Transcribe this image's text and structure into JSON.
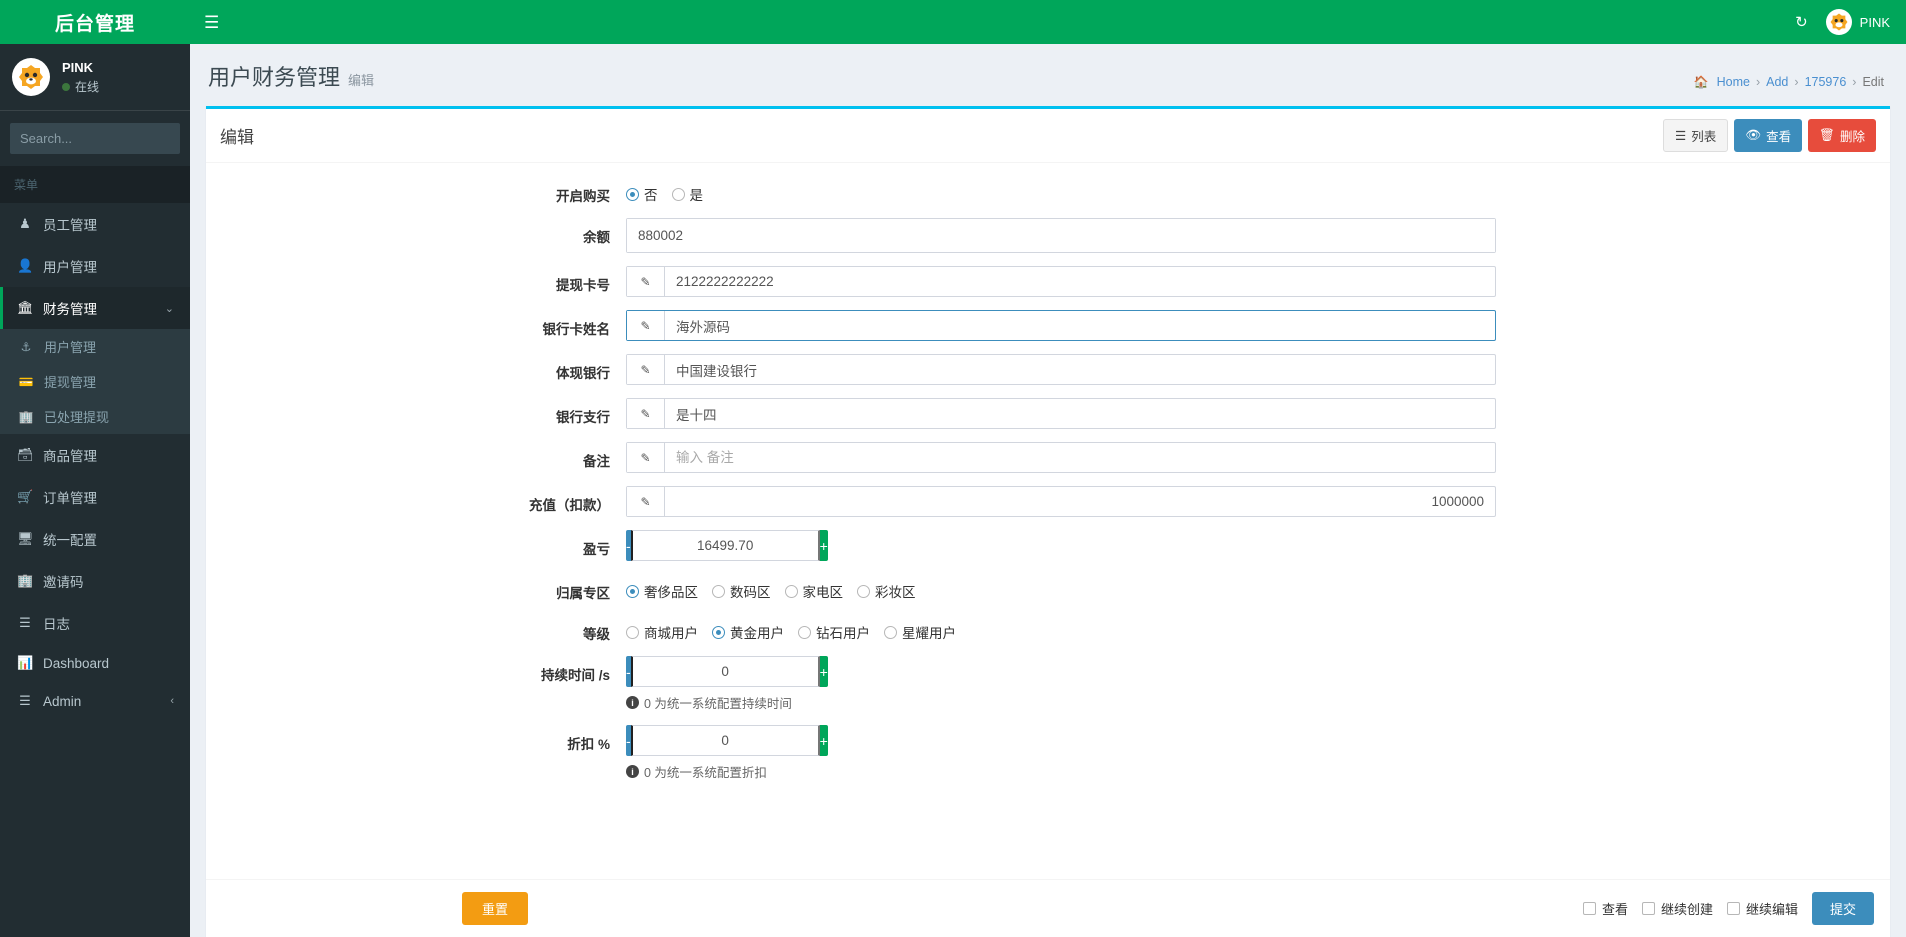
{
  "sidebar": {
    "logo": "后台管理",
    "user": {
      "name": "PINK",
      "status": "在线"
    },
    "search_placeholder": "Search...",
    "menu_header": "菜单",
    "items": [
      {
        "label": "员工管理",
        "icon": "person-icon"
      },
      {
        "label": "用户管理",
        "icon": "user-icon"
      },
      {
        "label": "财务管理",
        "icon": "bank-icon",
        "active": true,
        "chevron": "⌄"
      },
      {
        "label": "商品管理",
        "icon": "database-icon"
      },
      {
        "label": "订单管理",
        "icon": "cart-icon"
      },
      {
        "label": "统一配置",
        "icon": "monitor-icon"
      },
      {
        "label": "邀请码",
        "icon": "building-icon"
      },
      {
        "label": "日志",
        "icon": "list-icon"
      },
      {
        "label": "Dashboard",
        "icon": "chart-icon"
      },
      {
        "label": "Admin",
        "icon": "list-icon",
        "chevron": "‹"
      }
    ],
    "submenu": [
      {
        "label": "用户管理",
        "icon": "person-icon"
      },
      {
        "label": "提现管理",
        "icon": "card-icon"
      },
      {
        "label": "已处理提现",
        "icon": "building-icon"
      }
    ]
  },
  "topbar": {
    "menu_toggle": "☰",
    "refresh_icon": "refresh-icon",
    "user_name": "PINK"
  },
  "page": {
    "title": "用户财务管理",
    "subtitle": "编辑",
    "breadcrumb": [
      {
        "label": "Home",
        "icon": "home-icon"
      },
      {
        "label": "Add"
      },
      {
        "label": "175976"
      },
      {
        "label": "Edit",
        "current": true
      }
    ]
  },
  "card": {
    "title": "编辑",
    "buttons": [
      {
        "label": "列表",
        "icon": "list-icon",
        "style": "default"
      },
      {
        "label": "查看",
        "icon": "eye-icon",
        "style": "blue"
      },
      {
        "label": "删除",
        "icon": "trash-icon",
        "style": "red"
      }
    ]
  },
  "form": {
    "enable_buy": {
      "label": "开启购买",
      "options": [
        {
          "label": "否",
          "selected": true
        },
        {
          "label": "是",
          "selected": false
        }
      ]
    },
    "balance": {
      "label": "余额",
      "value": "880002"
    },
    "withdraw_card": {
      "label": "提现卡号",
      "value": "2122222222222",
      "addon": "pencil-icon"
    },
    "card_name": {
      "label": "银行卡姓名",
      "value": "海外源码",
      "addon": "pencil-icon",
      "focused": true
    },
    "bank": {
      "label": "体现银行",
      "value": "中国建设银行",
      "addon": "pencil-icon"
    },
    "branch": {
      "label": "银行支行",
      "value": "是十四",
      "addon": "pencil-icon"
    },
    "remark": {
      "label": "备注",
      "value": "",
      "placeholder": "输入 备注",
      "addon": "pencil-icon"
    },
    "recharge": {
      "label": "充值（扣款）",
      "value": "1000000",
      "addon": "pencil-icon",
      "align": "right"
    },
    "profit": {
      "label": "盈亏",
      "value": "16499.70",
      "minus": "-",
      "plus": "+"
    },
    "zone": {
      "label": "归属专区",
      "options": [
        {
          "label": "奢侈品区",
          "selected": true
        },
        {
          "label": "数码区",
          "selected": false
        },
        {
          "label": "家电区",
          "selected": false
        },
        {
          "label": "彩妆区",
          "selected": false
        }
      ]
    },
    "level": {
      "label": "等级",
      "options": [
        {
          "label": "商城用户",
          "selected": false
        },
        {
          "label": "黄金用户",
          "selected": true
        },
        {
          "label": "钻石用户",
          "selected": false
        },
        {
          "label": "星耀用户",
          "selected": false
        }
      ]
    },
    "duration": {
      "label": "持续时间 /s",
      "value": "0",
      "minus": "-",
      "plus": "+",
      "hint": "0 为统一系统配置持续时间"
    },
    "discount": {
      "label": "折扣 %",
      "value": "0",
      "minus": "-",
      "plus": "+",
      "hint": "0 为统一系统配置折扣"
    }
  },
  "footer": {
    "reset": "重置",
    "checkboxes": [
      {
        "label": "查看"
      },
      {
        "label": "继续创建"
      },
      {
        "label": "继续编辑"
      }
    ],
    "submit": "提交"
  }
}
